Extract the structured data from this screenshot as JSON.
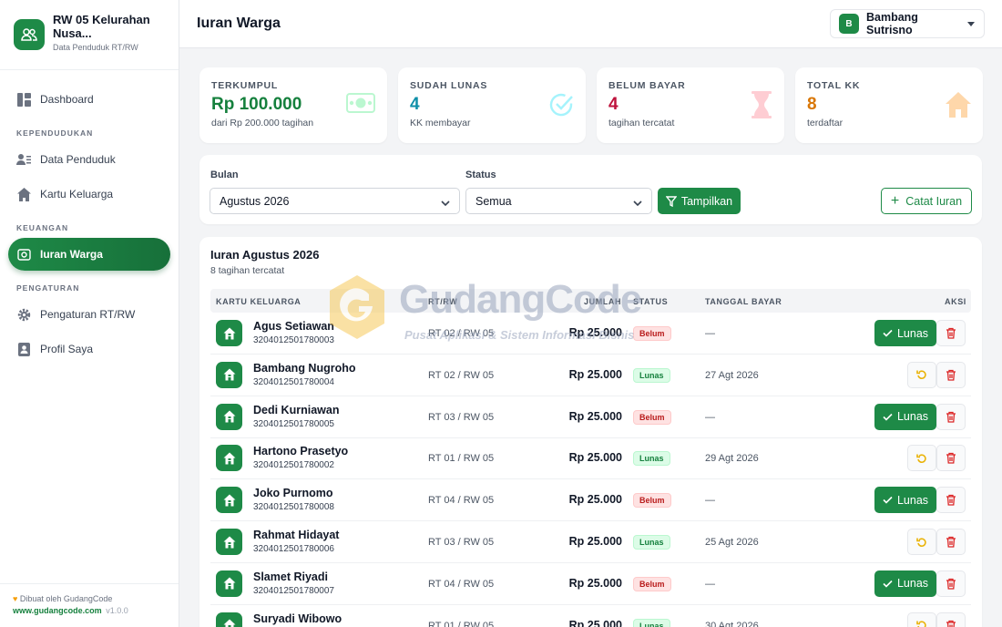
{
  "brand": {
    "title": "RW 05 Kelurahan Nusa...",
    "subtitle": "Data Penduduk RT/RW"
  },
  "nav": {
    "dashboard": "Dashboard",
    "section_kependudukan": "KEPENDUDUKAN",
    "data_penduduk": "Data Penduduk",
    "kartu_keluarga": "Kartu Keluarga",
    "section_keuangan": "KEUANGAN",
    "iuran_warga": "Iuran Warga",
    "section_pengaturan": "PENGATURAN",
    "pengaturan_rtrw": "Pengaturan RT/RW",
    "profil_saya": "Profil Saya"
  },
  "footer": {
    "made_by": "Dibuat oleh GudangCode",
    "link": "www.gudangcode.com",
    "version": "v1.0.0"
  },
  "header": {
    "title": "Iuran Warga",
    "user_initial": "B",
    "user_name": "Bambang Sutrisno"
  },
  "stats": [
    {
      "label": "TERKUMPUL",
      "value": "Rp 100.000",
      "sub": "dari Rp 200.000 tagihan",
      "color": "#15803d",
      "icon": "money-icon"
    },
    {
      "label": "SUDAH LUNAS",
      "value": "4",
      "sub": "KK membayar",
      "color": "#0e8fa8",
      "icon": "check-circle-icon"
    },
    {
      "label": "BELUM BAYAR",
      "value": "4",
      "sub": "tagihan tercatat",
      "color": "#be123c",
      "icon": "hourglass-icon"
    },
    {
      "label": "TOTAL KK",
      "value": "8",
      "sub": "terdaftar",
      "color": "#d97706",
      "icon": "house-icon"
    }
  ],
  "filter": {
    "bulan_label": "Bulan",
    "bulan_value": "Agustus 2026",
    "status_label": "Status",
    "status_value": "Semua",
    "show_button": "Tampilkan",
    "add_button": "Catat Iuran"
  },
  "table": {
    "title": "Iuran Agustus 2026",
    "subtitle": "8 tagihan tercatat",
    "columns": [
      "KARTU KELUARGA",
      "RT/RW",
      "JUMLAH",
      "STATUS",
      "TANGGAL BAYAR",
      "AKSI"
    ],
    "lunas_button": "Lunas",
    "rows": [
      {
        "name": "Agus Setiawan",
        "no_kk": "3204012501780003",
        "rtrw": "RT 02 / RW 05",
        "amount": "Rp 25.000",
        "status": "Belum",
        "date": "—"
      },
      {
        "name": "Bambang Nugroho",
        "no_kk": "3204012501780004",
        "rtrw": "RT 02 / RW 05",
        "amount": "Rp 25.000",
        "status": "Lunas",
        "date": "27 Agt 2026"
      },
      {
        "name": "Dedi Kurniawan",
        "no_kk": "3204012501780005",
        "rtrw": "RT 03 / RW 05",
        "amount": "Rp 25.000",
        "status": "Belum",
        "date": "—"
      },
      {
        "name": "Hartono Prasetyo",
        "no_kk": "3204012501780002",
        "rtrw": "RT 01 / RW 05",
        "amount": "Rp 25.000",
        "status": "Lunas",
        "date": "29 Agt 2026"
      },
      {
        "name": "Joko Purnomo",
        "no_kk": "3204012501780008",
        "rtrw": "RT 04 / RW 05",
        "amount": "Rp 25.000",
        "status": "Belum",
        "date": "—"
      },
      {
        "name": "Rahmat Hidayat",
        "no_kk": "3204012501780006",
        "rtrw": "RT 03 / RW 05",
        "amount": "Rp 25.000",
        "status": "Lunas",
        "date": "25 Agt 2026"
      },
      {
        "name": "Slamet Riyadi",
        "no_kk": "3204012501780007",
        "rtrw": "RT 04 / RW 05",
        "amount": "Rp 25.000",
        "status": "Belum",
        "date": "—"
      },
      {
        "name": "Suryadi Wibowo",
        "no_kk": "",
        "rtrw": "RT 01 / RW 05",
        "amount": "Rp 25.000",
        "status": "Lunas",
        "date": "30 Agt 2026"
      }
    ]
  },
  "watermark": {
    "title": "GudangCode",
    "subtitle": "Pusat Aplikasi & Sistem Informasi Bisnis"
  }
}
